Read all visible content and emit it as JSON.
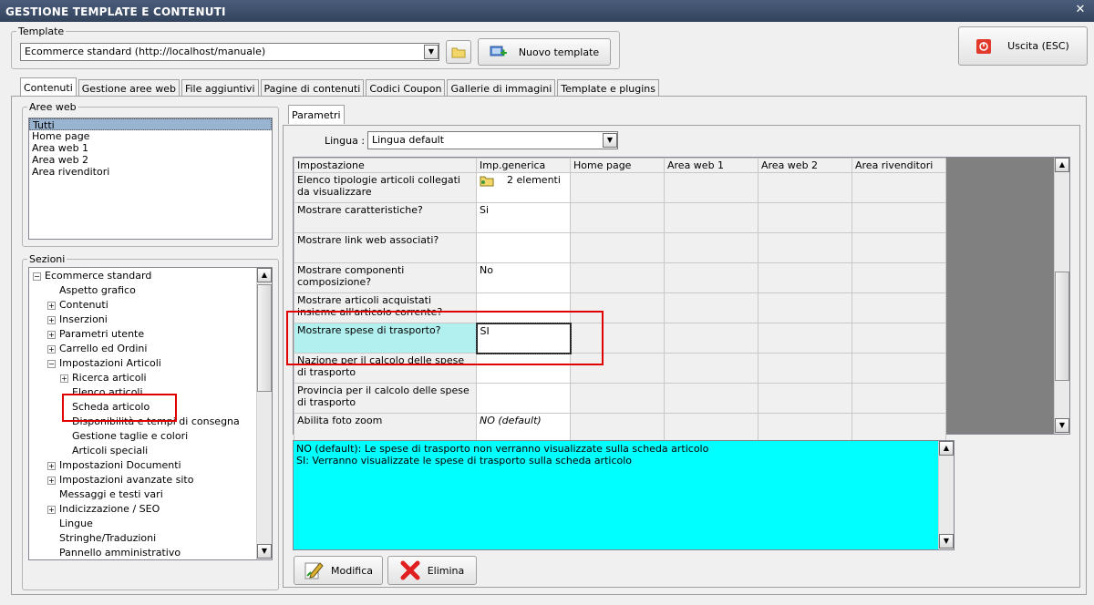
{
  "window": {
    "title": "GESTIONE TEMPLATE E CONTENUTI",
    "close_glyph": "✕"
  },
  "template": {
    "group_label": "Template",
    "selected": "Ecommerce standard (http://localhost/manuale)",
    "new_button": "Nuovo template"
  },
  "exit_button": "Uscita (ESC)",
  "tabs": [
    "Contenuti",
    "Gestione aree web",
    "File aggiuntivi",
    "Pagine di contenuti",
    "Codici Coupon",
    "Gallerie di immagini",
    "Template e plugins"
  ],
  "aree_web": {
    "label": "Aree web",
    "items": [
      "Tutti",
      "Home page",
      "Area web 1",
      "Area web 2",
      "Area rivenditori"
    ]
  },
  "sezioni": {
    "label": "Sezioni",
    "items": [
      {
        "text": "Ecommerce standard",
        "exp": "−",
        "level": 0
      },
      {
        "text": "Aspetto grafico",
        "exp": "",
        "level": 1
      },
      {
        "text": "Contenuti",
        "exp": "+",
        "level": 1
      },
      {
        "text": "Inserzioni",
        "exp": "+",
        "level": 1
      },
      {
        "text": "Parametri utente",
        "exp": "+",
        "level": 1
      },
      {
        "text": "Carrello ed Ordini",
        "exp": "+",
        "level": 1
      },
      {
        "text": "Impostazioni Articoli",
        "exp": "−",
        "level": 1
      },
      {
        "text": "Ricerca articoli",
        "exp": "+",
        "level": 2
      },
      {
        "text": "Elenco articoli",
        "exp": "",
        "level": 2
      },
      {
        "text": "Scheda articolo",
        "exp": "",
        "level": 2
      },
      {
        "text": "Disponibilità e tempi di consegna",
        "exp": "",
        "level": 2
      },
      {
        "text": "Gestione taglie e colori",
        "exp": "",
        "level": 2
      },
      {
        "text": "Articoli speciali",
        "exp": "",
        "level": 2
      },
      {
        "text": "Impostazioni Documenti",
        "exp": "+",
        "level": 1
      },
      {
        "text": "Impostazioni avanzate sito",
        "exp": "+",
        "level": 1
      },
      {
        "text": "Messaggi e testi vari",
        "exp": "",
        "level": 1
      },
      {
        "text": "Indicizzazione / SEO",
        "exp": "+",
        "level": 1
      },
      {
        "text": "Lingue",
        "exp": "",
        "level": 1
      },
      {
        "text": "Stringhe/Traduzioni",
        "exp": "",
        "level": 1
      },
      {
        "text": "Pannello amministrativo",
        "exp": "",
        "level": 1
      }
    ]
  },
  "parametri": {
    "tab": "Parametri",
    "lingua_label": "Lingua :",
    "lingua_value": "Lingua default",
    "columns": [
      "Impostazione",
      "Imp.generica",
      "Home page",
      "Area web 1",
      "Area web 2",
      "Area rivenditori"
    ],
    "rows": [
      {
        "name": "Elenco tipologie articoli collegati da visualizzare",
        "value": "2 elementi",
        "icon": true
      },
      {
        "name": "Mostrare caratteristiche?",
        "value": "Si"
      },
      {
        "name": "Mostrare link web associati?",
        "value": ""
      },
      {
        "name": "Mostrare componenti composizione?",
        "value": "No"
      },
      {
        "name": "Mostrare articoli acquistati insieme all'articolo corrente?",
        "value": ""
      },
      {
        "name": "Mostrare spese di trasporto?",
        "value": "SI"
      },
      {
        "name": "Nazione per il calcolo delle spese di trasporto",
        "value": ""
      },
      {
        "name": "Provincia per il calcolo delle spese di trasporto",
        "value": ""
      },
      {
        "name": "Abilita foto zoom",
        "value": "NO (default)"
      }
    ],
    "description": [
      "NO (default): Le spese di trasporto non verranno visualizzate sulla scheda articolo",
      "SI: Verranno visualizzate le spese di trasporto sulla scheda articolo"
    ],
    "modifica": "Modifica",
    "elimina": "Elimina"
  },
  "colors": {
    "highlight": "#e00000",
    "description_bg": "#00ffff",
    "selected_row": "#b2f0f0"
  }
}
